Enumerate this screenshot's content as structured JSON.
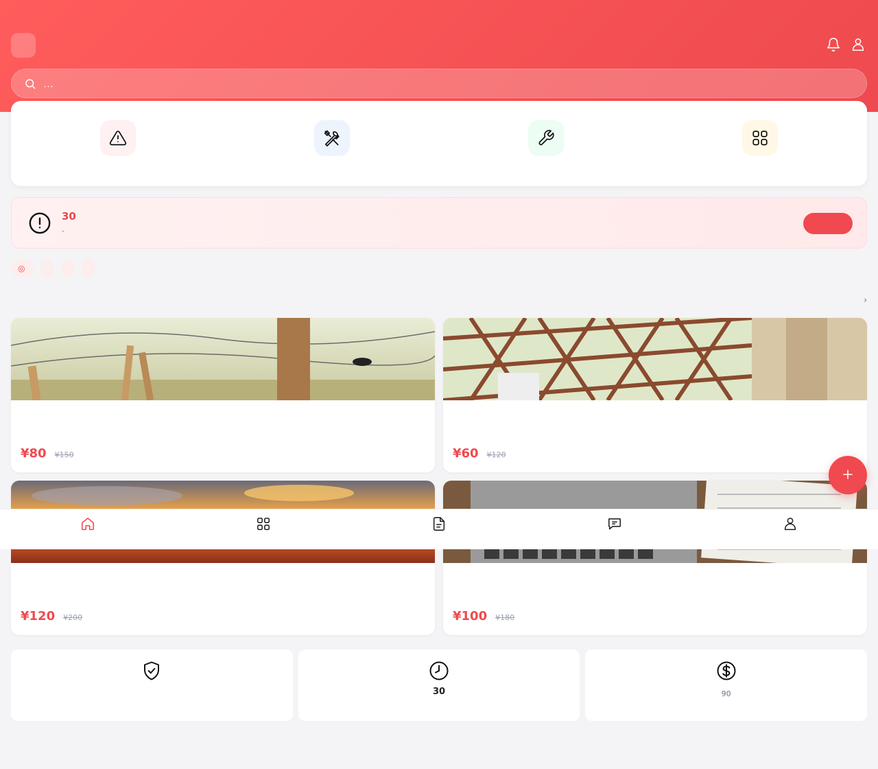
{
  "colors": {
    "brand": "#f0494f",
    "header_from": "#ff5c5c",
    "header_to": "#ee4a4f",
    "page_bg": "#f4f4f6"
  },
  "header": {
    "logo_glyph": "",
    "title": "",
    "icons": [
      "bell-icon",
      "user-icon"
    ]
  },
  "search": {
    "placeholder": "…",
    "value": ""
  },
  "quick_actions": [
    {
      "label": "",
      "icon": "alert-triangle-icon",
      "bg": "#fff1f1"
    },
    {
      "label": "",
      "icon": "tools-icon",
      "bg": "#eef4fd"
    },
    {
      "label": "",
      "icon": "wrench-icon",
      "bg": "#ecfdf3"
    },
    {
      "label": "",
      "icon": "grid-icon",
      "bg": "#fff8e6"
    }
  ],
  "alert": {
    "title": " 30",
    "subtitle": " · ",
    "button": ""
  },
  "tags": [
    {
      "prefix": "◎",
      "label": ""
    },
    {
      "prefix": "",
      "label": ""
    },
    {
      "prefix": "",
      "label": ""
    },
    {
      "prefix": "",
      "label": ""
    }
  ],
  "section": {
    "title": "",
    "more": " ›"
  },
  "services": [
    {
      "name": "",
      "desc": "",
      "price": "¥80",
      "unit": "",
      "old_price": "¥150"
    },
    {
      "name": "",
      "desc": "",
      "price": "¥60",
      "unit": "",
      "old_price": "¥120"
    },
    {
      "name": "",
      "desc": "",
      "price": "¥120",
      "unit": "",
      "old_price": "¥200"
    },
    {
      "name": "",
      "desc": "",
      "price": "¥100",
      "unit": "",
      "old_price": "¥180"
    }
  ],
  "bottom_nav": [
    {
      "label": "",
      "icon": "home-icon",
      "active": true
    },
    {
      "label": "",
      "icon": "grid-icon",
      "active": false
    },
    {
      "label": "",
      "icon": "document-icon",
      "active": false
    },
    {
      "label": "",
      "icon": "chat-icon",
      "active": false
    },
    {
      "label": "",
      "icon": "user-icon",
      "active": false
    }
  ],
  "fab": {
    "label": "",
    "icon": "plus-icon"
  },
  "features": [
    {
      "title": "",
      "subtitle": "",
      "icon": "shield-check-icon"
    },
    {
      "title": "30",
      "subtitle": "",
      "icon": "clock-icon"
    },
    {
      "title": "",
      "subtitle": "90",
      "icon": "dollar-icon"
    }
  ]
}
